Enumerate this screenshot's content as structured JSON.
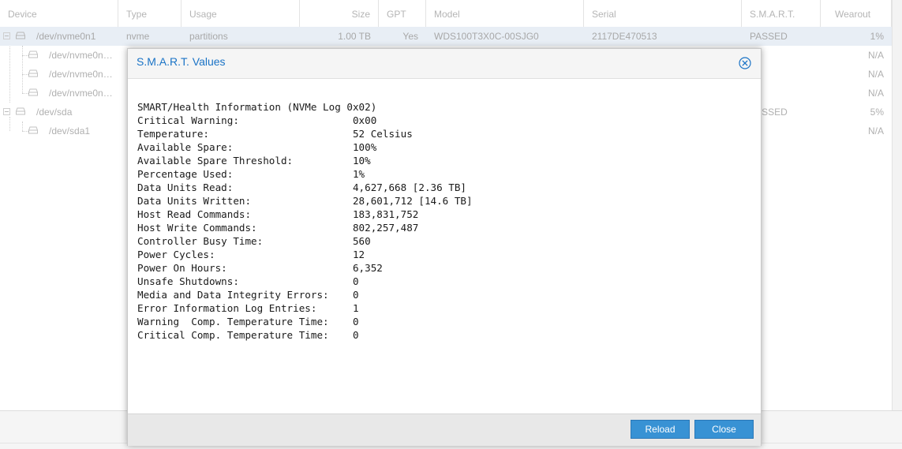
{
  "grid": {
    "columns": {
      "device": "Device",
      "type": "Type",
      "usage": "Usage",
      "size": "Size",
      "gpt": "GPT",
      "model": "Model",
      "serial": "Serial",
      "smart": "S.M.A.R.T.",
      "wearout": "Wearout"
    },
    "rows": [
      {
        "device": "/dev/nvme0n1",
        "type": "nvme",
        "usage": "partitions",
        "size": "1.00 TB",
        "gpt": "Yes",
        "model": "WDS100T3X0C-00SJG0",
        "serial": "2117DE470513",
        "smart": "PASSED",
        "wearout": "1%"
      },
      {
        "device": "/dev/nvme0n…",
        "wearout": "N/A"
      },
      {
        "device": "/dev/nvme0n…",
        "wearout": "N/A"
      },
      {
        "device": "/dev/nvme0n…",
        "wearout": "N/A"
      },
      {
        "device": "/dev/sda",
        "smart": "PASSED",
        "wearout": "5%"
      },
      {
        "device": "/dev/sda1",
        "wearout": "N/A"
      }
    ]
  },
  "modal": {
    "title": "S.M.A.R.T. Values",
    "smart_text": "SMART/Health Information (NVMe Log 0x02)\nCritical Warning:                   0x00\nTemperature:                        52 Celsius\nAvailable Spare:                    100%\nAvailable Spare Threshold:          10%\nPercentage Used:                    1%\nData Units Read:                    4,627,668 [2.36 TB]\nData Units Written:                 28,601,712 [14.6 TB]\nHost Read Commands:                 183,831,752\nHost Write Commands:                802,257,487\nController Busy Time:               560\nPower Cycles:                       12\nPower On Hours:                     6,352\nUnsafe Shutdowns:                   0\nMedia and Data Integrity Errors:    0\nError Information Log Entries:      1\nWarning  Comp. Temperature Time:    0\nCritical Comp. Temperature Time:    0",
    "reload_label": "Reload",
    "close_label": "Close",
    "close_icon": "close-circle-icon"
  },
  "colors": {
    "accent": "#3892d4",
    "title": "#1a73c6"
  }
}
